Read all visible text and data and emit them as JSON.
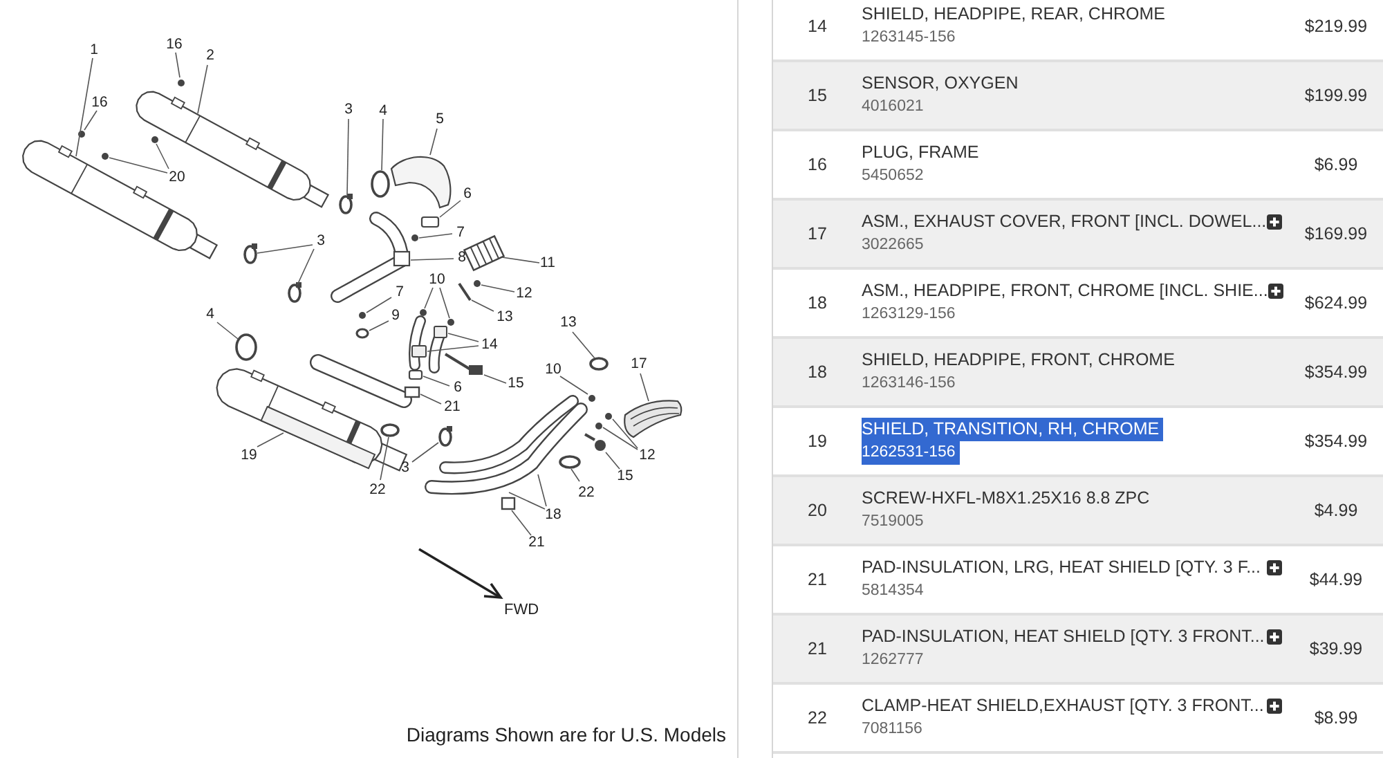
{
  "diagram": {
    "callouts": [
      {
        "label": "16"
      },
      {
        "label": "1"
      },
      {
        "label": "2"
      },
      {
        "label": "16"
      },
      {
        "label": "3"
      },
      {
        "label": "4"
      },
      {
        "label": "5"
      },
      {
        "label": "20"
      },
      {
        "label": "6"
      },
      {
        "label": "7"
      },
      {
        "label": "3"
      },
      {
        "label": "8"
      },
      {
        "label": "11"
      },
      {
        "label": "10"
      },
      {
        "label": "7"
      },
      {
        "label": "12"
      },
      {
        "label": "4"
      },
      {
        "label": "9"
      },
      {
        "label": "13"
      },
      {
        "label": "13"
      },
      {
        "label": "14"
      },
      {
        "label": "17"
      },
      {
        "label": "10"
      },
      {
        "label": "15"
      },
      {
        "label": "6"
      },
      {
        "label": "21"
      },
      {
        "label": "12"
      },
      {
        "label": "19"
      },
      {
        "label": "3"
      },
      {
        "label": "15"
      },
      {
        "label": "22"
      },
      {
        "label": "22"
      },
      {
        "label": "18"
      },
      {
        "label": "21"
      }
    ],
    "direction_label": "FWD",
    "caption": "Diagrams Shown are for U.S. Models"
  },
  "parts_table": {
    "rows": [
      {
        "ref": "14",
        "name": "SHIELD, HEADPIPE, REAR, CHROME",
        "part_number": "1263145-156",
        "price": "$219.99",
        "expandable": false,
        "highlighted": false
      },
      {
        "ref": "15",
        "name": "SENSOR, OXYGEN",
        "part_number": "4016021",
        "price": "$199.99",
        "expandable": false,
        "highlighted": false
      },
      {
        "ref": "16",
        "name": "PLUG, FRAME",
        "part_number": "5450652",
        "price": "$6.99",
        "expandable": false,
        "highlighted": false
      },
      {
        "ref": "17",
        "name": "ASM., EXHAUST COVER, FRONT [INCL. DOWEL...",
        "part_number": "3022665",
        "price": "$169.99",
        "expandable": true,
        "highlighted": false
      },
      {
        "ref": "18",
        "name": "ASM., HEADPIPE, FRONT, CHROME [INCL. SHIE...",
        "part_number": "1263129-156",
        "price": "$624.99",
        "expandable": true,
        "highlighted": false
      },
      {
        "ref": "18",
        "name": "SHIELD, HEADPIPE, FRONT, CHROME",
        "part_number": "1263146-156",
        "price": "$354.99",
        "expandable": false,
        "highlighted": false
      },
      {
        "ref": "19",
        "name": "SHIELD, TRANSITION, RH, CHROME",
        "part_number": "1262531-156",
        "price": "$354.99",
        "expandable": false,
        "highlighted": true
      },
      {
        "ref": "20",
        "name": "SCREW-HXFL-M8X1.25X16 8.8 ZPC",
        "part_number": "7519005",
        "price": "$4.99",
        "expandable": false,
        "highlighted": false
      },
      {
        "ref": "21",
        "name": "PAD-INSULATION, LRG, HEAT SHIELD [QTY. 3 F...",
        "part_number": "5814354",
        "price": "$44.99",
        "expandable": true,
        "highlighted": false
      },
      {
        "ref": "21",
        "name": "PAD-INSULATION, HEAT SHIELD [QTY. 3 FRONT...",
        "part_number": "1262777",
        "price": "$39.99",
        "expandable": true,
        "highlighted": false
      },
      {
        "ref": "22",
        "name": "CLAMP-HEAT SHIELD,EXHAUST [QTY. 3 FRONT...",
        "part_number": "7081156",
        "price": "$8.99",
        "expandable": true,
        "highlighted": false
      }
    ]
  }
}
